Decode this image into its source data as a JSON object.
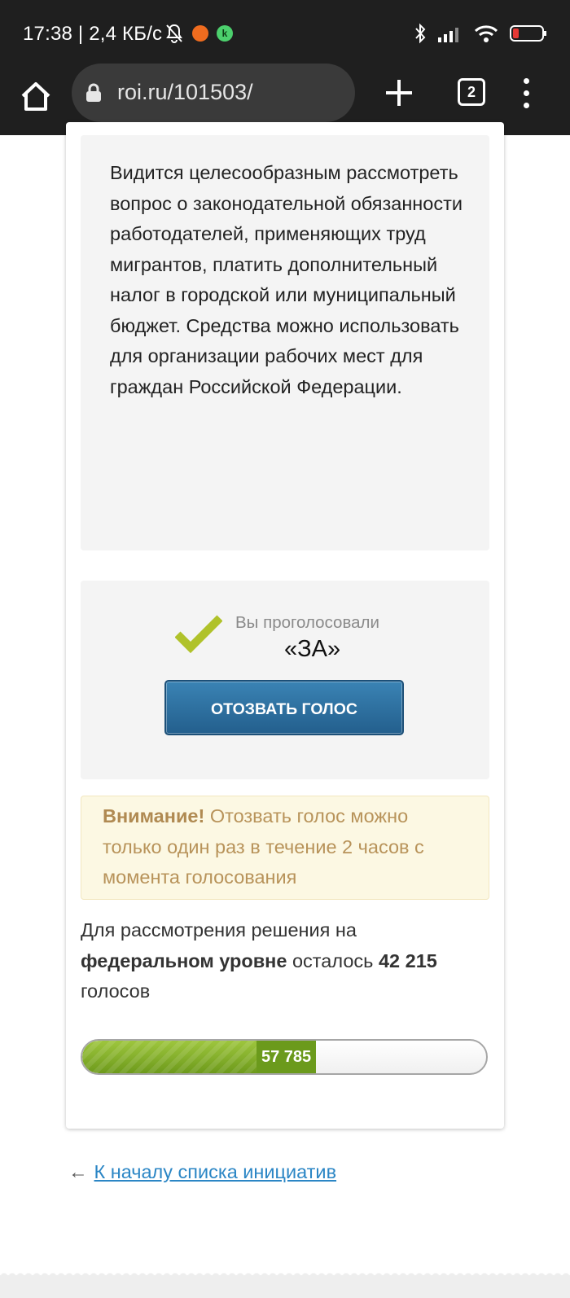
{
  "status_bar": {
    "time": "17:38 | 2,4 КБ/с",
    "notification_icon_text": "k"
  },
  "browser": {
    "url": "roi.ru/101503/",
    "tab_count": "2"
  },
  "initiative": {
    "text": "Видится целесообразным рассмотреть вопрос о законодательной обязанности работодателей, применяющих труд мигрантов, платить дополнительный налог в городской или муниципальный бюджет. Средства можно использовать для организации рабочих мест для граждан Российской Федерации."
  },
  "vote": {
    "voted_label": "Вы проголосовали",
    "voted_value": "«ЗА»",
    "revoke_button": "ОТОЗВАТЬ ГОЛОС"
  },
  "warning": {
    "title": "Внимание!",
    "text": " Отозвать голос можно только один раз в течение 2 часов с момента голосования"
  },
  "remaining": {
    "prefix": "Для рассмотрения решения на ",
    "level": "федеральном уровне",
    "middle": " осталось ",
    "count": "42 215",
    "suffix": " голосов"
  },
  "progress": {
    "label": "57 785",
    "fraction": 0.578
  },
  "back_link": {
    "arrow": "←",
    "label": "К началу списка инициатив"
  },
  "colors": {
    "accent_button": "#2a6e9f",
    "progress_green": "#7fab2a",
    "link": "#2b86c5",
    "warning_text": "#b8935a"
  }
}
